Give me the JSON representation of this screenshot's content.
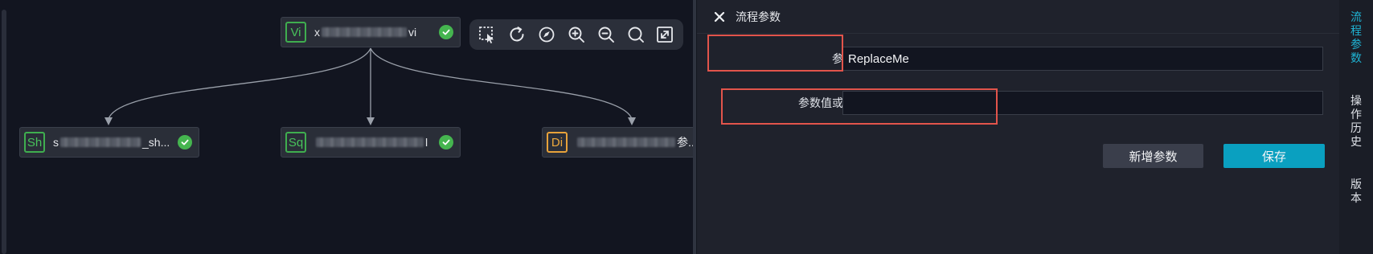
{
  "canvas": {
    "toolbar": {
      "tools": [
        {
          "icon": "box-select-icon"
        },
        {
          "icon": "refresh-icon"
        },
        {
          "icon": "locate-icon"
        },
        {
          "icon": "zoom-in-icon"
        },
        {
          "icon": "zoom-out-icon"
        },
        {
          "icon": "search-icon"
        },
        {
          "icon": "fit-screen-icon"
        }
      ]
    },
    "nodes": {
      "root": {
        "badge": "Vi",
        "name_prefix": "x",
        "name_suffix": "vi",
        "status": "success",
        "color": "#3fae4f"
      },
      "left": {
        "badge": "Sh",
        "name_prefix": "s",
        "name_suffix": "_sh...",
        "status": "success",
        "color": "#3fae4f"
      },
      "middle": {
        "badge": "Sq",
        "name_prefix": "",
        "name_suffix": "l",
        "status": "success",
        "color": "#3fae4f"
      },
      "right": {
        "badge": "Di",
        "name_prefix": "",
        "name_suffix": "参...",
        "status": "none",
        "color": "#e8a23a"
      }
    }
  },
  "panel": {
    "title": "流程参数",
    "close_icon": "close-icon",
    "fields": {
      "name": {
        "label": "参数名称：",
        "value": "ReplaceMe"
      },
      "value": {
        "label": "参数值或表达式：",
        "value": ""
      }
    },
    "buttons": {
      "add": "新增参数",
      "save": "保存"
    },
    "colors": {
      "accent": "#0aa0c0",
      "highlight": "#e2544b"
    }
  },
  "rail": {
    "tabs": [
      {
        "label": "流程参数",
        "active": true
      },
      {
        "label": "操作历史",
        "active": false
      },
      {
        "label": "版本",
        "active": false
      }
    ]
  }
}
